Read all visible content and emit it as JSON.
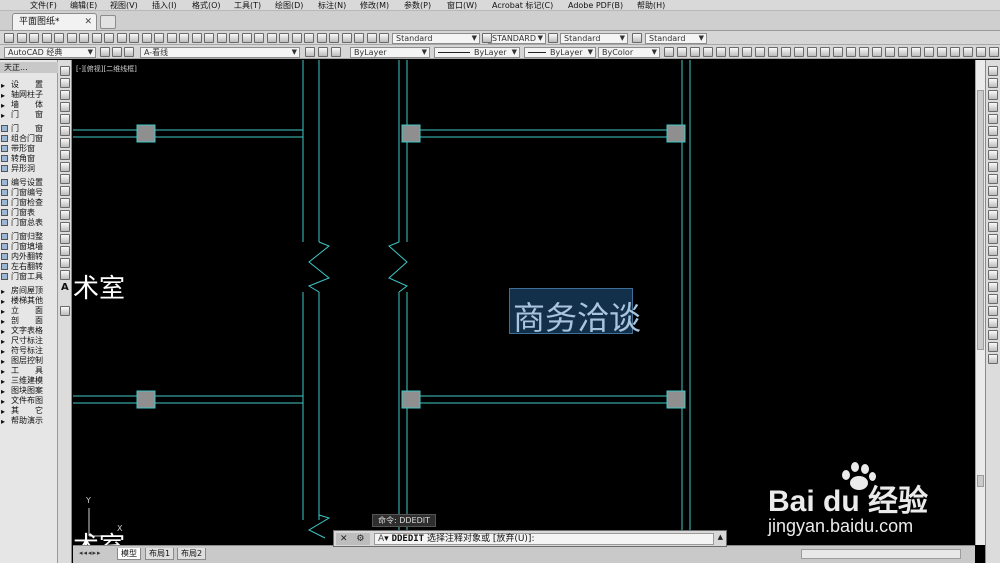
{
  "menu": [
    "文件(F)",
    "编辑(E)",
    "视图(V)",
    "插入(I)",
    "格式(O)",
    "工具(T)",
    "绘图(D)",
    "标注(N)",
    "修改(M)",
    "参数(P)",
    "窗口(W)",
    "Acrobat 标记(C)",
    "Adobe PDF(B)",
    "帮助(H)"
  ],
  "doc_tab": {
    "title": "平面图纸*",
    "close": "✕"
  },
  "toolbar": {
    "text_style": "Standard",
    "dim_style": "STANDARD",
    "table_style": "Standard",
    "multileader_style": "Standard",
    "workspace": "AutoCAD 经典",
    "layer": "A-看线",
    "color": "ByLayer",
    "linetype": "ByLayer",
    "lineweight": "ByLayer",
    "plot_style": "ByColor"
  },
  "palette": {
    "title": "天正...",
    "items": [
      "设　　置",
      "轴网柱子",
      "墙　　体",
      "门　　窗",
      "门　　窗",
      "组合门窗",
      "带形窗",
      "转角窗",
      "异形洞",
      "编号设置",
      "门窗编号",
      "门窗检查",
      "门窗表",
      "门窗总表",
      "门窗归整",
      "门窗填墙",
      "内外翻转",
      "左右翻转",
      "门窗工具",
      "房间屋顶",
      "楼梯其他",
      "立　　面",
      "剖　　面",
      "文字表格",
      "尺寸标注",
      "符号标注",
      "图层控制",
      "工　　具",
      "三维建模",
      "图块图案",
      "文件布图",
      "其　　它",
      "帮助演示"
    ]
  },
  "viewport_label": "[-][俯视][二维线框]",
  "drawing": {
    "room_left_top": "术室",
    "room_left_bottom": "术室",
    "selected_text": "商务洽谈",
    "wall_color": "#3fc7c7",
    "column_color": "#9a9a9a"
  },
  "ucs": {
    "y": "Y",
    "x": "X"
  },
  "layout_tabs": [
    "模型",
    "布局1",
    "布局2"
  ],
  "command": {
    "tip": "命令: DDEDIT",
    "close": "✕",
    "wrench": "🔧",
    "text_icon": "A",
    "name": "DDEDIT",
    "prompt": "选择注释对象或 [放弃(U)]:"
  },
  "watermark": {
    "brand": "Bai du 经验",
    "url": "jingyan.baidu.com"
  }
}
